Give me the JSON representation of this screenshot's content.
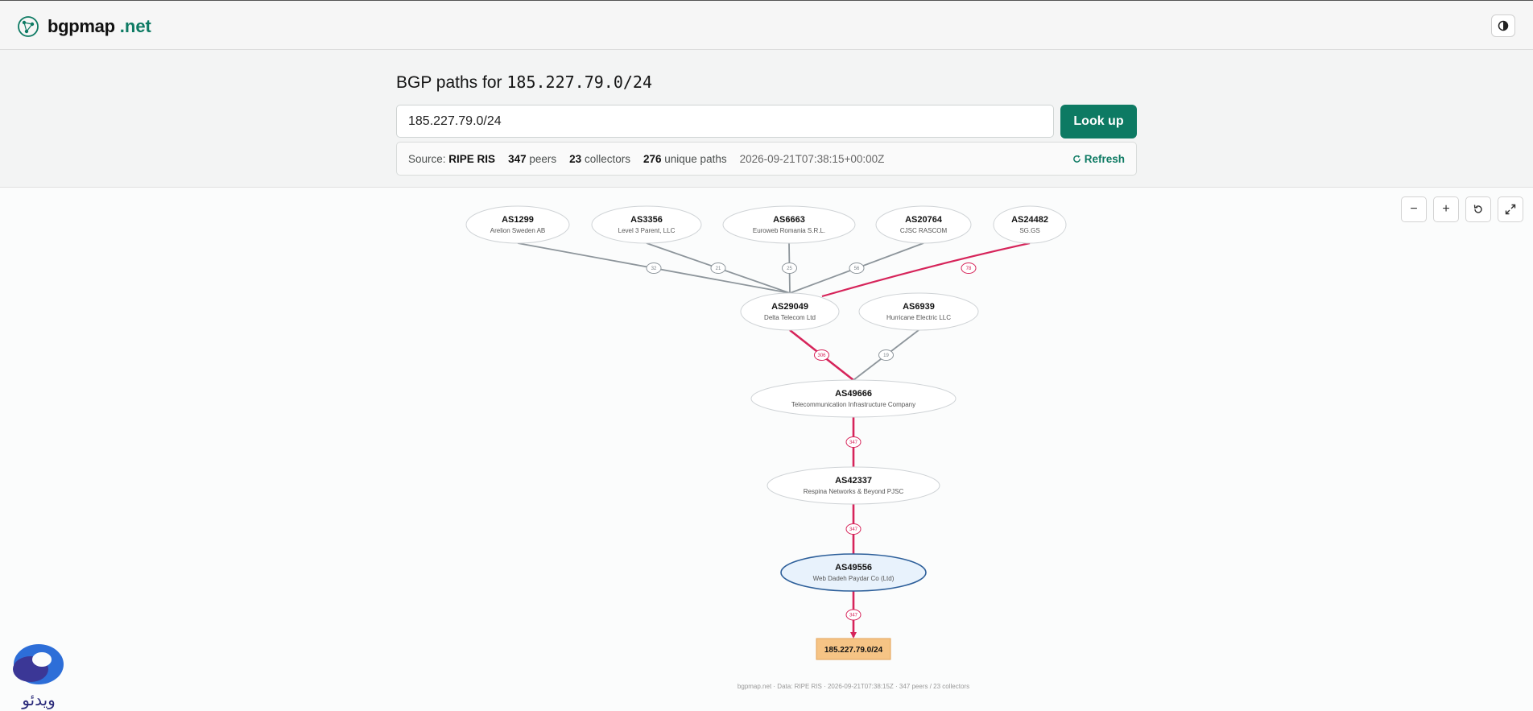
{
  "app": {
    "logo_name": "bgpmap",
    "logo_tld": ".net",
    "logo_icon": "globe-icon",
    "theme_icon": "contrast-icon"
  },
  "query": {
    "title_prefix": "BGP paths for",
    "prefix": "185.227.79.0/24",
    "input_value": "185.227.79.0/24",
    "lookup_label": "Look up"
  },
  "info": {
    "source_label": "Source:",
    "source": "RIPE RIS",
    "peers_count": "347",
    "peers_label": "peers",
    "collectors_count": "23",
    "collectors_label": "collectors",
    "paths_count": "276",
    "paths_label": "unique paths",
    "timestamp": "2026-09-21T07:38:15+00:00Z",
    "refresh_label": "Refresh"
  },
  "controls": {
    "zoom_out": "−",
    "zoom_in": "+",
    "reset_icon": "reset-icon",
    "fullscreen_icon": "fullscreen-icon"
  },
  "graph": {
    "nodes": [
      {
        "id": "n1299",
        "asn": "AS1299",
        "name": "Arelion Sweden AB"
      },
      {
        "id": "n3356",
        "asn": "AS3356",
        "name": "Level 3 Parent, LLC"
      },
      {
        "id": "n6663",
        "asn": "AS6663",
        "name": "Euroweb Romania S.R.L."
      },
      {
        "id": "n20764",
        "asn": "AS20764",
        "name": "CJSC RASCOM"
      },
      {
        "id": "n24482",
        "asn": "AS24482",
        "name": "SG.GS"
      },
      {
        "id": "n29049",
        "asn": "AS29049",
        "name": "Delta Telecom Ltd"
      },
      {
        "id": "n6939",
        "asn": "AS6939",
        "name": "Hurricane Electric LLC"
      },
      {
        "id": "n49666",
        "asn": "AS49666",
        "name": "Telecommunication Infrastructure Company"
      },
      {
        "id": "n42337",
        "asn": "AS42337",
        "name": "Respina Networks & Beyond PJSC"
      },
      {
        "id": "n49556",
        "asn": "AS49556",
        "name": "Web Dadeh Paydar Co (Ltd)",
        "origin": true
      },
      {
        "id": "prefix",
        "asn": "185.227.79.0/24",
        "name": "",
        "prefix": true
      }
    ],
    "edges": [
      {
        "from": "n1299",
        "to": "n29049",
        "count": "32",
        "primary": false
      },
      {
        "from": "n3356",
        "to": "n29049",
        "count": "21",
        "primary": false
      },
      {
        "from": "n6663",
        "to": "n29049",
        "count": "25",
        "primary": false
      },
      {
        "from": "n20764",
        "to": "n29049",
        "count": "56",
        "primary": false
      },
      {
        "from": "n24482",
        "to": "n29049",
        "count": "78",
        "primary": true
      },
      {
        "from": "n29049",
        "to": "n49666",
        "count": "306",
        "primary": true
      },
      {
        "from": "n6939",
        "to": "n49666",
        "count": "19",
        "primary": false
      },
      {
        "from": "n49666",
        "to": "n42337",
        "count": "347",
        "primary": true
      },
      {
        "from": "n42337",
        "to": "n49556",
        "count": "347",
        "primary": true
      },
      {
        "from": "n49556",
        "to": "prefix",
        "count": "347",
        "primary": true
      }
    ]
  },
  "footer": {
    "text": "bgpmap.net · Data: RIPE RIS · 2026-09-21T07:38:15Z · 347 peers / 23 collectors"
  },
  "colors": {
    "accent": "#0d7a63",
    "primary_path": "#d6245a",
    "secondary_path": "#8d959b",
    "origin_fill": "#e8f2fc",
    "origin_stroke": "#2d5f9a",
    "prefix_fill": "#f6c485"
  },
  "watermark": {
    "text": "ويدئو"
  }
}
